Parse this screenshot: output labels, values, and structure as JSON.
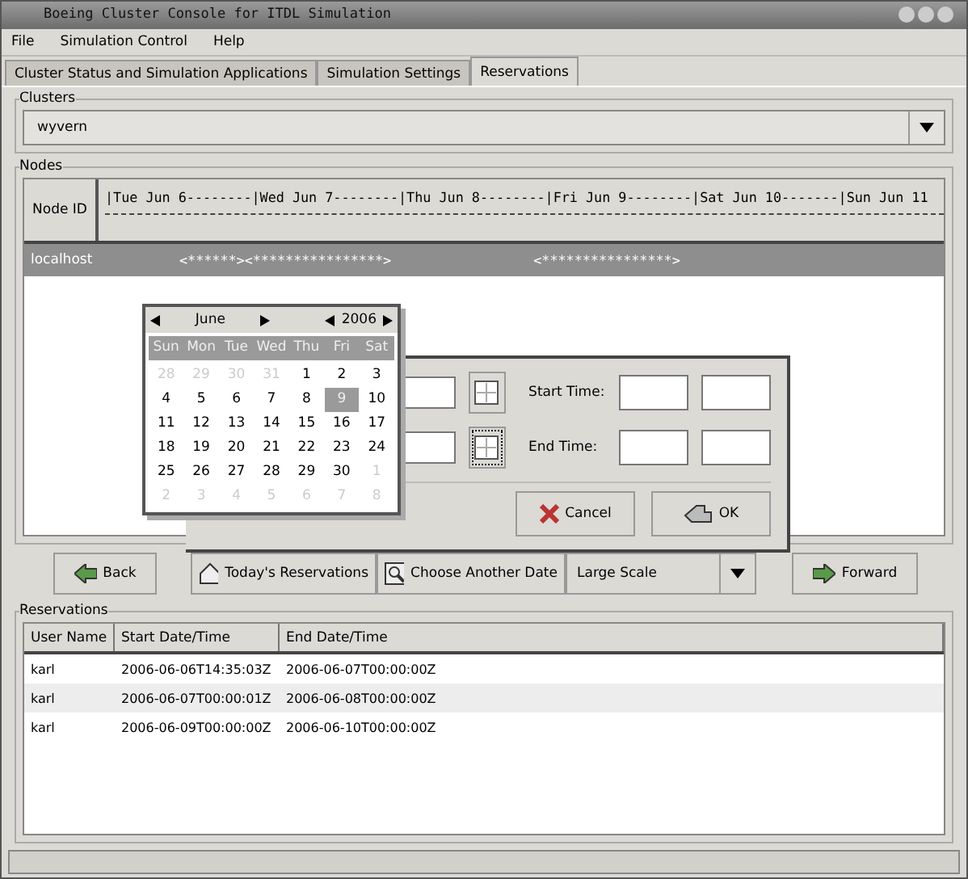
{
  "window": {
    "title": "Boeing Cluster Console for ITDL Simulation"
  },
  "menu": [
    "File",
    "Simulation Control",
    "Help"
  ],
  "tabs": [
    {
      "label": "Cluster Status and Simulation Applications",
      "selected": false
    },
    {
      "label": "Simulation Settings",
      "selected": false
    },
    {
      "label": "Reservations",
      "selected": true
    }
  ],
  "clusters": {
    "legend": "Clusters",
    "value": "wyvern"
  },
  "nodes": {
    "legend": "Nodes",
    "id_header": "Node ID",
    "timeline_header": "|Tue Jun 6--------|Wed Jun 7--------|Thu Jun 8--------|Fri Jun 9--------|Sat Jun 10-------|Sun Jun 11",
    "rows": [
      {
        "name": "localhost",
        "selected": true,
        "bars": [
          "<******><****************>",
          "<****************>"
        ]
      }
    ]
  },
  "calendar": {
    "month": "June",
    "year": "2006",
    "weekdays": [
      "Sun",
      "Mon",
      "Tue",
      "Wed",
      "Thu",
      "Fri",
      "Sat"
    ],
    "days": [
      {
        "label": "28",
        "other_month": true,
        "selected": false
      },
      {
        "label": "29",
        "other_month": true,
        "selected": false
      },
      {
        "label": "30",
        "other_month": true,
        "selected": false
      },
      {
        "label": "31",
        "other_month": true,
        "selected": false
      },
      {
        "label": "1",
        "other_month": false,
        "selected": false
      },
      {
        "label": "2",
        "other_month": false,
        "selected": false
      },
      {
        "label": "3",
        "other_month": false,
        "selected": false
      },
      {
        "label": "4",
        "other_month": false,
        "selected": false
      },
      {
        "label": "5",
        "other_month": false,
        "selected": false
      },
      {
        "label": "6",
        "other_month": false,
        "selected": false
      },
      {
        "label": "7",
        "other_month": false,
        "selected": false
      },
      {
        "label": "8",
        "other_month": false,
        "selected": false
      },
      {
        "label": "9",
        "other_month": false,
        "selected": true
      },
      {
        "label": "10",
        "other_month": false,
        "selected": false
      },
      {
        "label": "11",
        "other_month": false,
        "selected": false
      },
      {
        "label": "12",
        "other_month": false,
        "selected": false
      },
      {
        "label": "13",
        "other_month": false,
        "selected": false
      },
      {
        "label": "14",
        "other_month": false,
        "selected": false
      },
      {
        "label": "15",
        "other_month": false,
        "selected": false
      },
      {
        "label": "16",
        "other_month": false,
        "selected": false
      },
      {
        "label": "17",
        "other_month": false,
        "selected": false
      },
      {
        "label": "18",
        "other_month": false,
        "selected": false
      },
      {
        "label": "19",
        "other_month": false,
        "selected": false
      },
      {
        "label": "20",
        "other_month": false,
        "selected": false
      },
      {
        "label": "21",
        "other_month": false,
        "selected": false
      },
      {
        "label": "22",
        "other_month": false,
        "selected": false
      },
      {
        "label": "23",
        "other_month": false,
        "selected": false
      },
      {
        "label": "24",
        "other_month": false,
        "selected": false
      },
      {
        "label": "25",
        "other_month": false,
        "selected": false
      },
      {
        "label": "26",
        "other_month": false,
        "selected": false
      },
      {
        "label": "27",
        "other_month": false,
        "selected": false
      },
      {
        "label": "28",
        "other_month": false,
        "selected": false
      },
      {
        "label": "29",
        "other_month": false,
        "selected": false
      },
      {
        "label": "30",
        "other_month": false,
        "selected": false
      },
      {
        "label": "1",
        "other_month": true,
        "selected": false
      },
      {
        "label": "2",
        "other_month": true,
        "selected": false
      },
      {
        "label": "3",
        "other_month": true,
        "selected": false
      },
      {
        "label": "4",
        "other_month": true,
        "selected": false
      },
      {
        "label": "5",
        "other_month": true,
        "selected": false
      },
      {
        "label": "6",
        "other_month": true,
        "selected": false
      },
      {
        "label": "7",
        "other_month": true,
        "selected": false
      },
      {
        "label": "8",
        "other_month": true,
        "selected": false
      }
    ]
  },
  "dialog": {
    "start_label": "Start Time:",
    "end_label": "End Time:",
    "cancel": "Cancel",
    "ok": "OK"
  },
  "toolbar": {
    "back": "Back",
    "today": "Today's Reservations",
    "choose": "Choose Another Date",
    "scale": "Large Scale",
    "forward": "Forward"
  },
  "reservations": {
    "legend": "Reservations",
    "columns": [
      "User Name",
      "Start Date/Time",
      "End Date/Time"
    ],
    "rows": [
      [
        "karl",
        "2006-06-06T14:35:03Z",
        "2006-06-07T00:00:00Z"
      ],
      [
        "karl",
        "2006-06-07T00:00:01Z",
        "2006-06-08T00:00:00Z"
      ],
      [
        "karl",
        "2006-06-09T00:00:00Z",
        "2006-06-10T00:00:00Z"
      ]
    ]
  }
}
